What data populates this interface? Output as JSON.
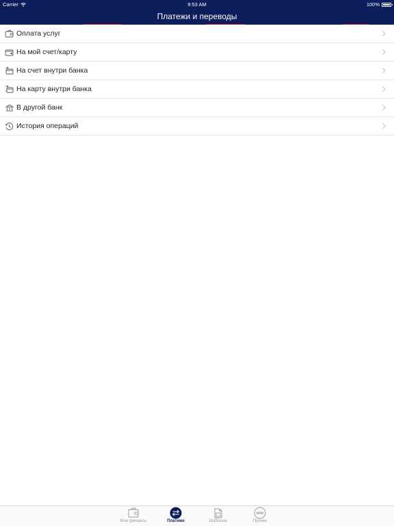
{
  "status_bar": {
    "carrier": "Carrier",
    "time": "9:53 AM",
    "battery": "100%",
    "battery_level": 1.0
  },
  "nav": {
    "title": "Платежи и переводы"
  },
  "menu": {
    "items": [
      {
        "label": "Оплата услуг",
        "icon": "wallet-icon"
      },
      {
        "label": "На мой счет/карту",
        "icon": "card-wallet-icon"
      },
      {
        "label": "На счет внутри банка",
        "icon": "bank-account-icon"
      },
      {
        "label": "На карту внутри банка",
        "icon": "card-transfer-icon"
      },
      {
        "label": "В другой банк",
        "icon": "other-bank-icon"
      },
      {
        "label": "История операций",
        "icon": "history-icon"
      }
    ]
  },
  "tabs": [
    {
      "label": "Мои финансы",
      "icon": "wallet-icon",
      "active": false
    },
    {
      "label": "Платежи",
      "icon": "transfer-arrows-icon",
      "active": true
    },
    {
      "label": "Шаблоны",
      "icon": "templates-icon",
      "active": false
    },
    {
      "label": "Прочее",
      "icon": "more-icon",
      "active": false
    }
  ],
  "colors": {
    "brand": "#0c1d5b",
    "tab_inactive": "#9a9aa0",
    "separator": "#e3e3e6"
  }
}
